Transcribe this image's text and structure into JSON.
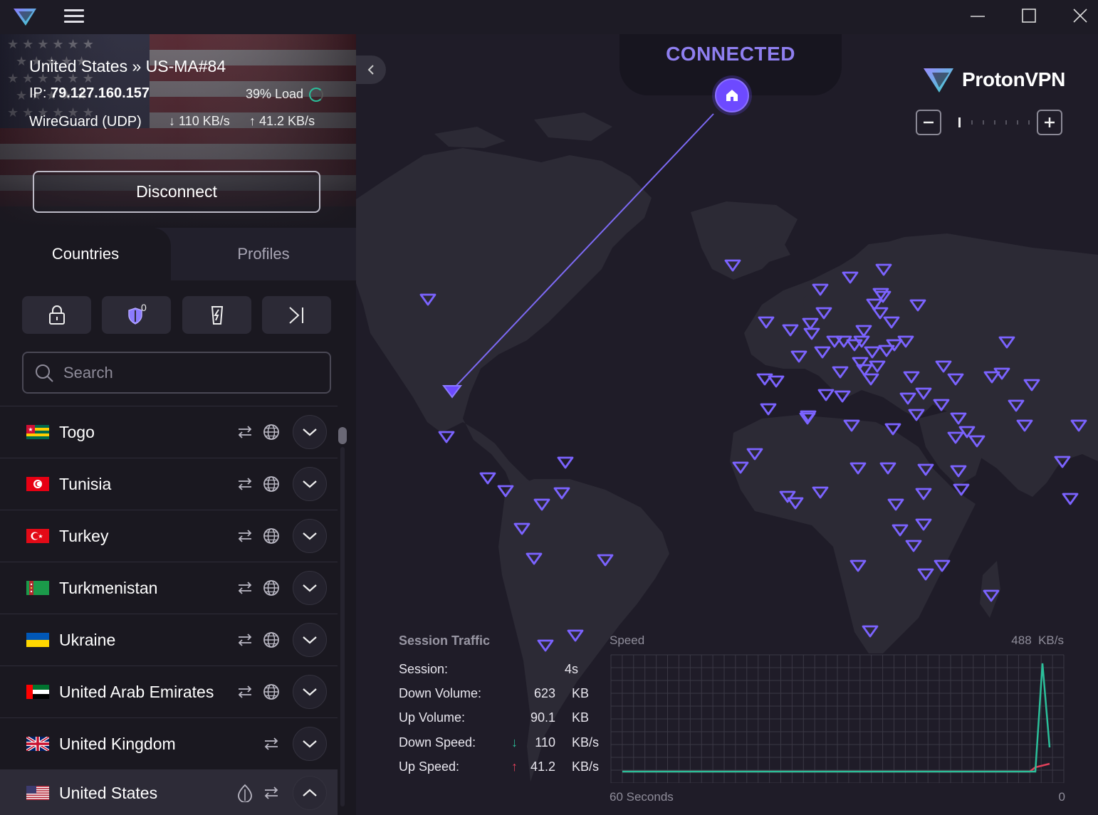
{
  "window": {
    "minimize": "minimize",
    "maximize": "maximize",
    "close": "close"
  },
  "connection": {
    "title": "United States » US-MA#84",
    "ip_label": "IP: ",
    "ip": "79.127.160.157",
    "load": "39% Load",
    "protocol": "WireGuard (UDP)",
    "down": "110 KB/s",
    "up": "41.2 KB/s",
    "disconnect_label": "Disconnect"
  },
  "tabs": {
    "countries": "Countries",
    "profiles": "Profiles"
  },
  "filters": {
    "netshield_count": "0"
  },
  "search": {
    "placeholder": "Search"
  },
  "countries": [
    {
      "name": "Togo",
      "icons": [
        "p2p",
        "tor"
      ],
      "expanded": false
    },
    {
      "name": "Tunisia",
      "icons": [
        "p2p",
        "tor"
      ],
      "expanded": false
    },
    {
      "name": "Turkey",
      "icons": [
        "p2p",
        "tor"
      ],
      "expanded": false
    },
    {
      "name": "Turkmenistan",
      "icons": [
        "p2p",
        "tor"
      ],
      "expanded": false
    },
    {
      "name": "Ukraine",
      "icons": [
        "p2p",
        "tor"
      ],
      "expanded": false
    },
    {
      "name": "United Arab Emirates",
      "icons": [
        "p2p",
        "tor"
      ],
      "expanded": false
    },
    {
      "name": "United Kingdom",
      "icons": [
        "p2p"
      ],
      "expanded": false
    },
    {
      "name": "United States",
      "icons": [
        "streaming",
        "p2p"
      ],
      "expanded": true
    }
  ],
  "map": {
    "status": "CONNECTED",
    "brand": "ProtonVPN",
    "accent": "#6d4aff",
    "status_color": "#8f7ff0"
  },
  "session": {
    "title": "Session Traffic",
    "rows": [
      {
        "label": "Session:",
        "value": "4s",
        "unit": ""
      },
      {
        "label": "Down Volume:",
        "value": "623",
        "unit": "KB"
      },
      {
        "label": "Up Volume:",
        "value": "90.1",
        "unit": "KB"
      },
      {
        "label": "Down Speed:",
        "value": "110",
        "unit": "KB/s"
      },
      {
        "label": "Up Speed:",
        "value": "41.2",
        "unit": "KB/s"
      }
    ]
  },
  "speed_chart": {
    "title": "Speed",
    "max_label": "488  KB/s",
    "x_start_label": "60 Seconds",
    "x_end_label": "0",
    "down_color": "#2bbf9a",
    "up_color": "#e0405a"
  }
}
